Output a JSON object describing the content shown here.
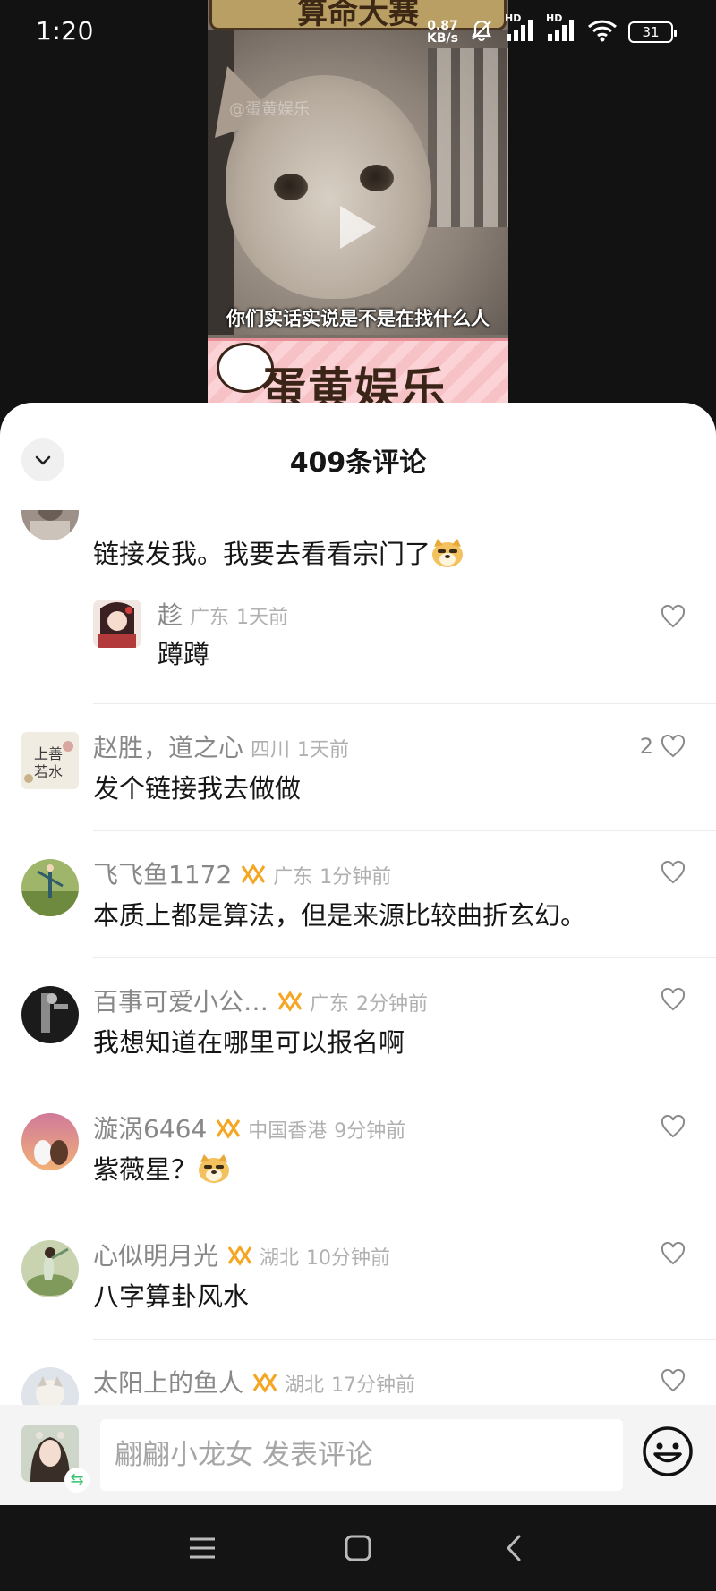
{
  "status_bar": {
    "time": "1:20",
    "net_speed_value": "0.87",
    "net_speed_unit": "KB/s",
    "signal_label_1": "HD",
    "signal_label_2": "HD",
    "battery": "31"
  },
  "video": {
    "top_banner_text": "算命大赛",
    "watermark": "@蛋黄娱乐",
    "subtitle": "你们实话实说是不是在找什么人",
    "bottom_banner_text": "蛋黄娱乐"
  },
  "sheet": {
    "title": "409条评论"
  },
  "comments": [
    {
      "text": "链接发我。我要去看看宗门了",
      "text_emoji": "doge-emoji"
    },
    {
      "name": "趁",
      "location": "广东",
      "time": "1天前",
      "text": "蹲蹲"
    },
    {
      "name": "赵胜，道之心",
      "location": "四川",
      "time": "1天前",
      "text": "发个链接我去做做",
      "likes": "2"
    },
    {
      "name": "飞飞鱼1172",
      "location": "广东",
      "time": "1分钟前",
      "text": "本质上都是算法，但是来源比较曲折玄幻。"
    },
    {
      "name": "百事可爱小公…",
      "location": "广东",
      "time": "2分钟前",
      "text": "我想知道在哪里可以报名啊"
    },
    {
      "name": "漩涡6464",
      "location": "中国香港",
      "time": "9分钟前",
      "text": "紫薇星？",
      "text_emoji": "doge-emoji"
    },
    {
      "name": "心似明月光",
      "location": "湖北",
      "time": "10分钟前",
      "text": "八字算卦风水"
    },
    {
      "name": "太阳上的鱼人",
      "location": "湖北",
      "time": "17分钟前"
    }
  ],
  "input_bar": {
    "placeholder": "翩翩小龙女 发表评论",
    "switch_symbol": "⇆"
  },
  "colors": {
    "sheet_bg": "#ffffff",
    "name_gray": "#888888",
    "fan_badge": "#f5a623",
    "app_bg": "#121212"
  }
}
